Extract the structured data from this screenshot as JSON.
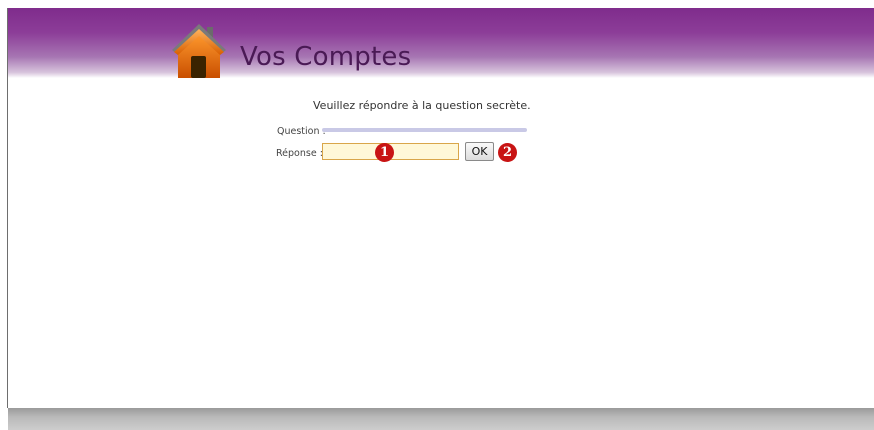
{
  "header": {
    "title": "Vos Comptes",
    "logo_icon": "house-icon",
    "brand_color": "#862f93"
  },
  "form": {
    "prompt": "Veuillez répondre à la question secrète.",
    "question_label": "Question :",
    "question_text": "",
    "answer_label": "Réponse :",
    "answer_value": "",
    "submit_label": "OK"
  },
  "markers": {
    "one": "1",
    "two": "2"
  }
}
